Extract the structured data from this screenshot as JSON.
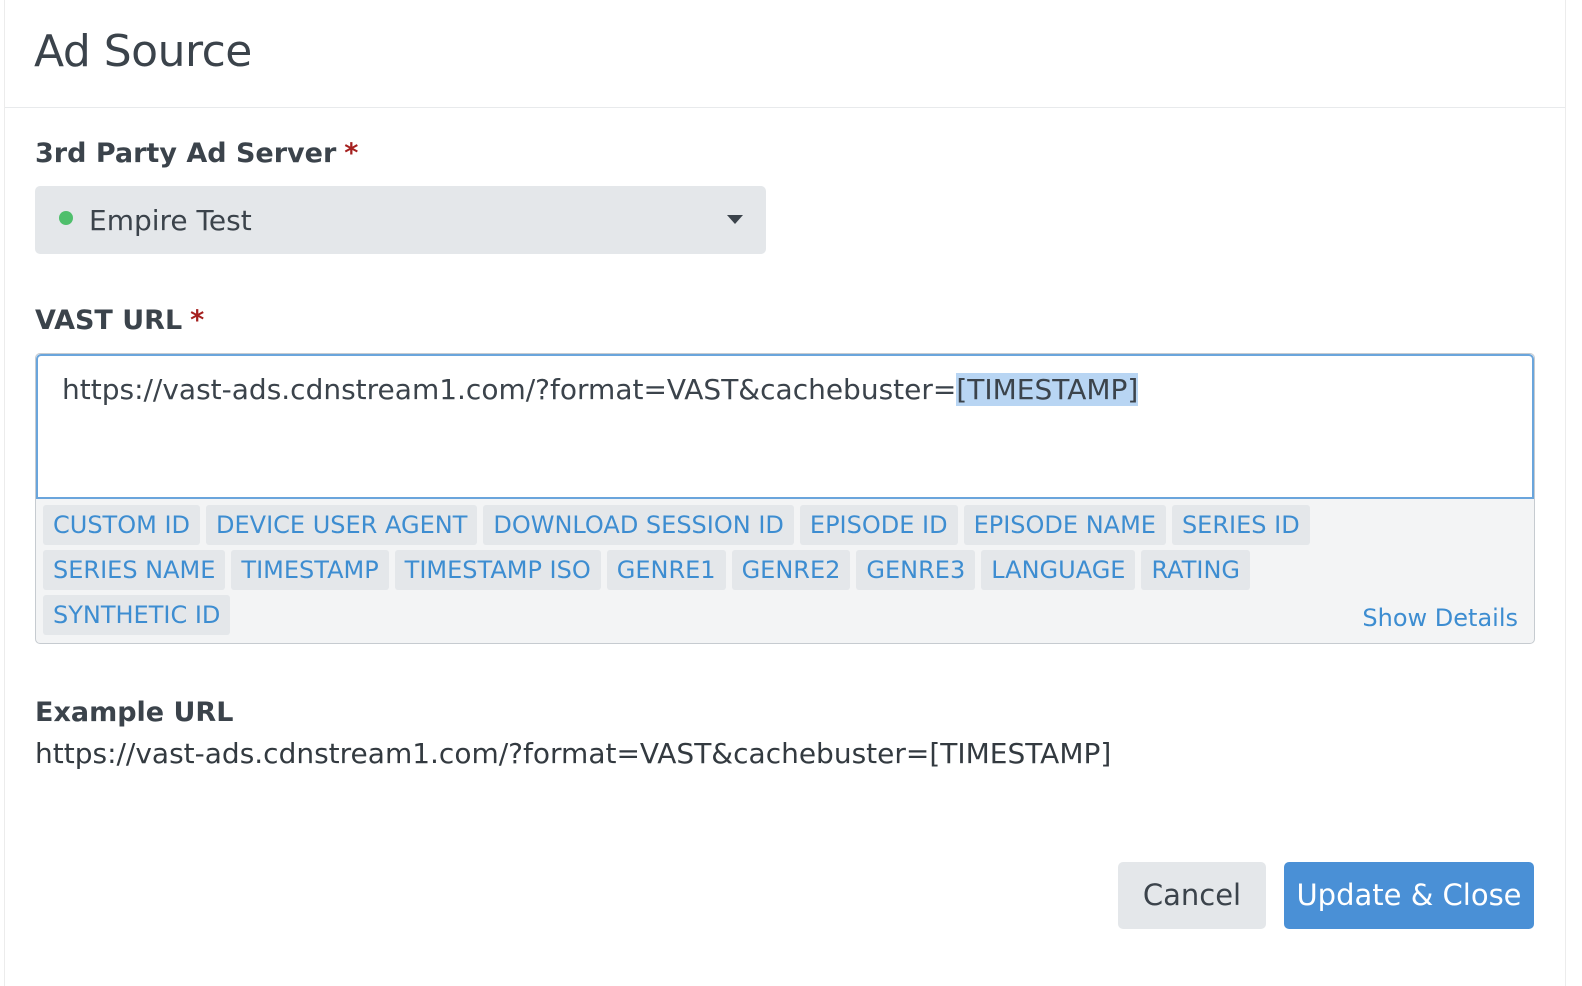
{
  "header": {
    "title": "Ad Source"
  },
  "ad_server": {
    "label": "3rd Party Ad Server",
    "required_mark": "*",
    "selected_value": "Empire Test",
    "status_color": "#4fbf6c"
  },
  "vast_url": {
    "label": "VAST URL",
    "required_mark": "*",
    "value_prefix": "https://vast-ads.cdnstream1.com/?format=VAST&cachebuster=",
    "value_selected": "[TIMESTAMP]",
    "macro_rows": [
      [
        "CUSTOM ID",
        "DEVICE USER AGENT",
        "DOWNLOAD SESSION ID",
        "EPISODE ID",
        "EPISODE NAME",
        "SERIES ID"
      ],
      [
        "SERIES NAME",
        "TIMESTAMP",
        "TIMESTAMP ISO",
        "GENRE1",
        "GENRE2",
        "GENRE3",
        "LANGUAGE",
        "RATING"
      ],
      [
        "SYNTHETIC ID"
      ]
    ],
    "show_details_label": "Show Details"
  },
  "example": {
    "label": "Example URL",
    "url": "https://vast-ads.cdnstream1.com/?format=VAST&cachebuster=[TIMESTAMP]"
  },
  "footer": {
    "cancel_label": "Cancel",
    "submit_label": "Update & Close"
  },
  "colors": {
    "accent": "#4a90d6",
    "link": "#3d8dd1",
    "required": "#a5201f",
    "tag_bg": "#e4e7ea"
  }
}
